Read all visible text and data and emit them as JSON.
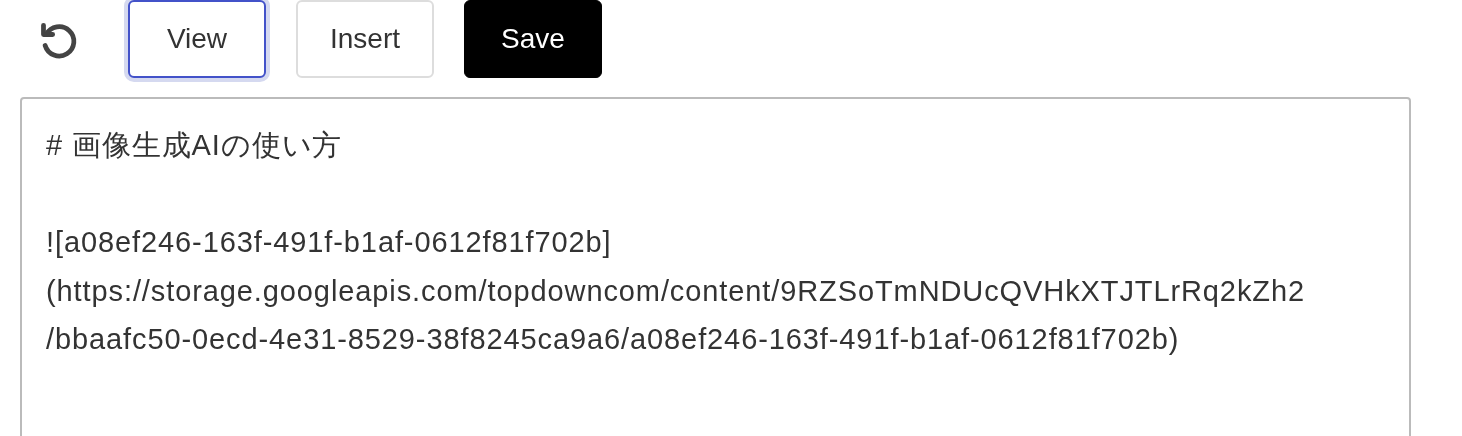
{
  "toolbar": {
    "buttons": [
      {
        "label": "View",
        "kind": "toggle",
        "selected": true
      },
      {
        "label": "Insert",
        "kind": "toggle",
        "selected": false
      },
      {
        "label": "Save",
        "kind": "primary"
      }
    ]
  },
  "editor": {
    "paragraphs": [
      {
        "lines": [
          "# 画像生成AIの使い方"
        ]
      },
      {
        "lines": [
          "![a08ef246-163f-491f-b1af-0612f81f702b]",
          "(https://storage.googleapis.com/topdowncom/content/9RZSoTmNDUcQVHkXTJTLrRq2kZh2",
          "/bbaafc50-0ecd-4e31-8529-38f8245ca9a6/a08ef246-163f-491f-b1af-0612f81f702b)"
        ]
      }
    ]
  }
}
